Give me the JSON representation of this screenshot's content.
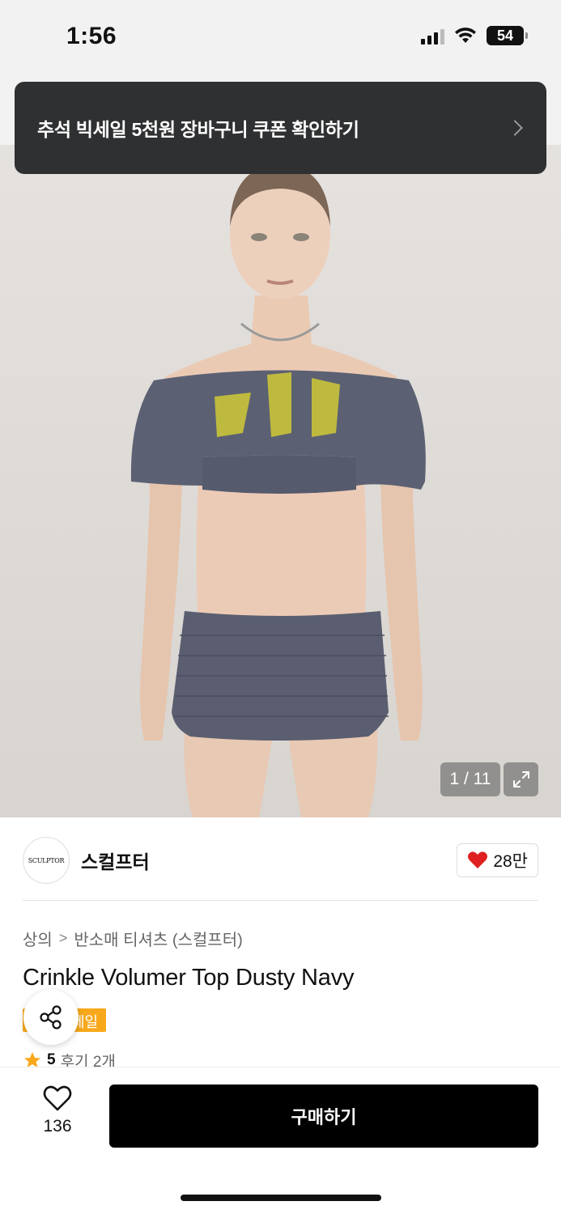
{
  "status_bar": {
    "time": "1:56",
    "battery": "54"
  },
  "promo_banner": {
    "text": "추석 빅세일 5천원 장바구니 쿠폰 확인하기"
  },
  "gallery": {
    "page_counter": "1 / 11",
    "current_index": 1,
    "total": 11
  },
  "brand": {
    "logo_text": "SCULPTOR",
    "name": "스컬프터",
    "likes": "28만"
  },
  "breadcrumb": {
    "category": "상의",
    "subcategory": "반소매 티셔츠 (스컬프터)"
  },
  "product": {
    "title": "Crinkle Volumer Top Dusty Navy",
    "badge": "세일"
  },
  "rating": {
    "score": "5",
    "reviews": "후기 2개"
  },
  "bottom_bar": {
    "wish_count": "136",
    "buy_label": "구매하기"
  },
  "colors": {
    "banner_bg": "#2f3032",
    "sale_badge": "#f7a81b",
    "heart": "#e02020",
    "buy_button": "#000000"
  }
}
